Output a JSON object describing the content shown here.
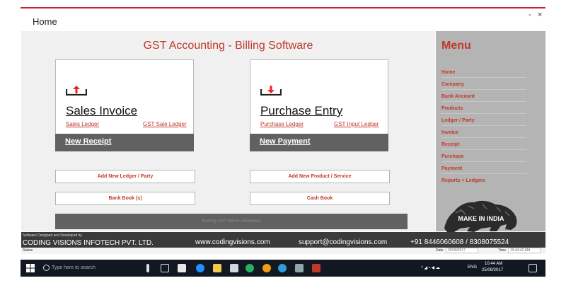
{
  "window": {
    "title": "Home",
    "minimize_label": "-",
    "close_label": "×"
  },
  "app_title": "GST Accounting - Billing Software",
  "sales_card": {
    "title": "Sales Invoice",
    "link1": "Sales Ledger",
    "link2": "GST Sale Ledger",
    "footer": "New Receipt",
    "icon": "upload-tray-icon"
  },
  "purchase_card": {
    "title": "Purchase Entry",
    "link1": "Purchase Ledger",
    "link2": "GST Input Ledger",
    "footer": "New Payment",
    "icon": "download-tray-icon"
  },
  "buttons": {
    "add_ledger": "Add New Ledger / Party",
    "add_product": "Add New Product / Service",
    "bank_book": "Bank Book (s)",
    "cash_book": "Cash Book",
    "gst_return": "Monthly GST Return Download"
  },
  "menu": {
    "title": "Menu",
    "items": [
      "Home",
      "Company",
      "Bank Account",
      "Products",
      "Ledger / Party",
      "Invoice",
      "Receipt",
      "Purchase",
      "Payment",
      "Reports + Ledgers"
    ],
    "logo_text": "MAKE IN INDIA"
  },
  "footer": {
    "designed_by": "Software Designed and Developed by",
    "company": "CODING VISIONS INFOTECH PVT. LTD.",
    "website": "www.codingvisions.com",
    "email": "support@codingvisions.com",
    "phone": "+91 8446060608 / 8308075524"
  },
  "status_bar": {
    "status_label": "Status",
    "date_label": "Date",
    "date_value": "25/09/2017",
    "time_label": "Time",
    "time_value": "10:44:42 AM"
  },
  "taskbar": {
    "search_placeholder": "Type here to search",
    "language": "ENG",
    "time": "10:44 AM",
    "date": "25/09/2017"
  },
  "colors": {
    "accent": "#c0392b",
    "card_footer": "#616161",
    "menu_bg": "#b4b4b4",
    "footer_bg": "#3a3a3a"
  }
}
